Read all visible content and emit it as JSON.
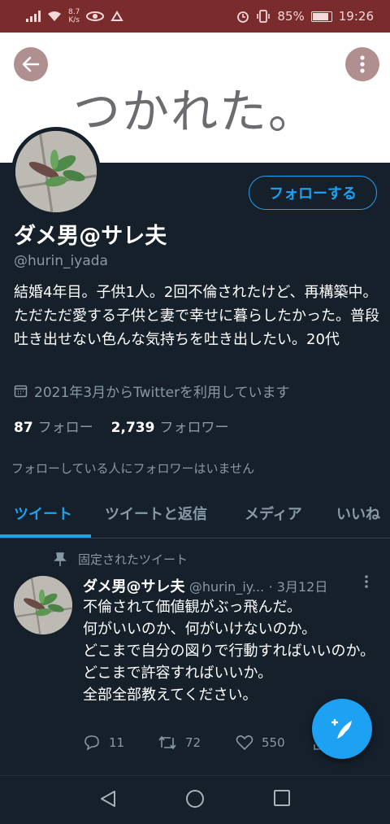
{
  "status_bar": {
    "network_speed": "8.7",
    "network_unit": "K/s",
    "battery": "85%",
    "time": "19:26"
  },
  "banner": {
    "text": "つかれた。"
  },
  "profile": {
    "follow_label": "フォローする",
    "name": "ダメ男@サレ夫",
    "handle": "@hurin_iyada",
    "bio": "結婚4年目。子供1人。2回不倫されたけど、再構築中。ただただ愛する子供と妻で幸せに暮らしたかった。普段吐き出せない色んな気持ちを吐き出したい。20代",
    "joined": "2021年3月からTwitterを利用しています",
    "following_count": "87",
    "following_label": "フォロー",
    "followers_count": "2,739",
    "followers_label": "フォロワー",
    "followed_note": "フォローしている人にフォロワーはいません"
  },
  "tabs": [
    {
      "label": "ツイート"
    },
    {
      "label": "ツイートと返信"
    },
    {
      "label": "メディア"
    },
    {
      "label": "いいね"
    }
  ],
  "tweet": {
    "pinned_label": "固定されたツイート",
    "name": "ダメ男@サレ夫",
    "handle": "@hurin_iy...",
    "date": "· 3月12日",
    "text": "不倫されて価値観がぶっ飛んだ。\n何がいいのか、何がいけないのか。\nどこまで自分の図りで行動すればいいのか。\nどこまで許容すればいいか。\n全部全部教えてください。",
    "replies": "11",
    "retweets": "72",
    "likes": "550"
  },
  "colors": {
    "accent": "#1da1f2",
    "background": "#15202b",
    "status_bar": "#7a2b2b",
    "secondary_text": "#8899a6"
  }
}
